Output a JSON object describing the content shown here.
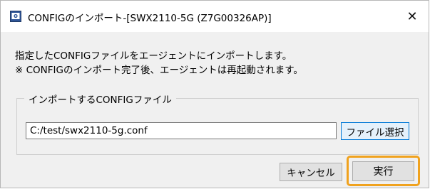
{
  "window": {
    "title": "CONFIGのインポート-[SWX2110-5G (Z7G00326AP)]",
    "app_icon": "window-app-icon",
    "close_glyph": "✕"
  },
  "message": {
    "line1": "指定したCONFIGファイルをエージェントにインポートします。",
    "line2": "※ CONFIGのインポート完了後、エージェントは再起動されます。"
  },
  "config_group": {
    "label": "インポートするCONFIGファイル",
    "path_value": "C:/test/swx2110-5g.conf",
    "browse_label": "ファイル選択"
  },
  "buttons": {
    "cancel_label": "キャンセル",
    "run_label": "実行"
  },
  "colors": {
    "highlight": "#f0a21e",
    "accent": "#0078d7"
  }
}
